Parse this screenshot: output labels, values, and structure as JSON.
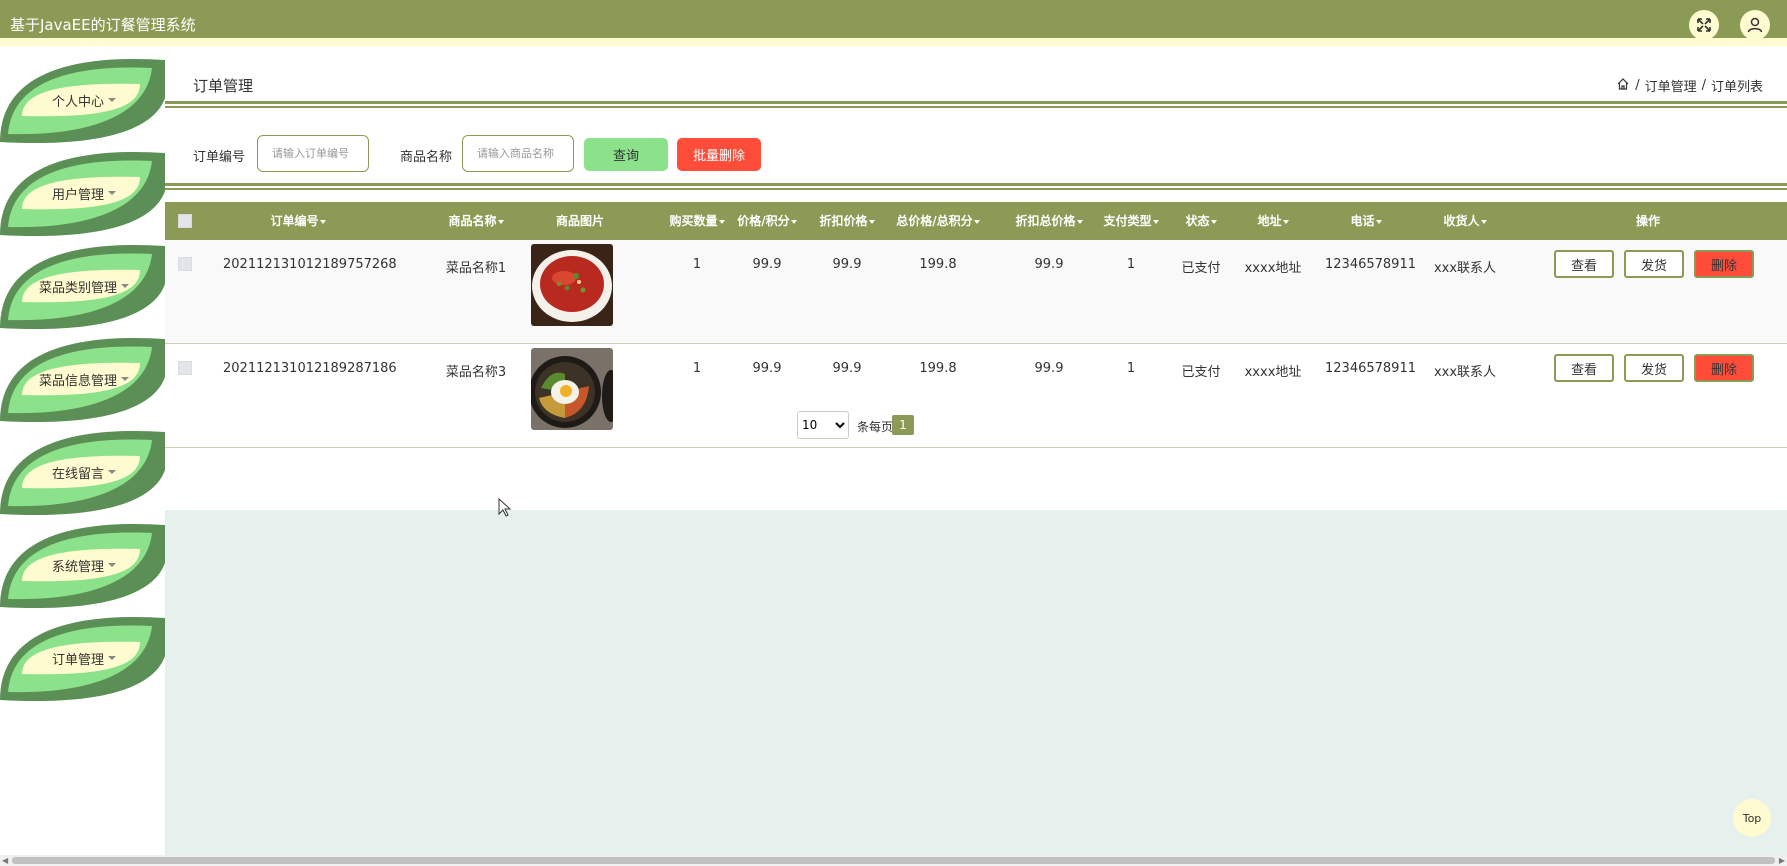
{
  "app": {
    "title": "基于JavaEE的订餐管理系统"
  },
  "header_icons": [
    "fullscreen-icon",
    "user-icon"
  ],
  "sidebar": {
    "items": [
      {
        "label": "个人中心"
      },
      {
        "label": "用户管理"
      },
      {
        "label": "菜品类别管理"
      },
      {
        "label": "菜品信息管理"
      },
      {
        "label": "在线留言"
      },
      {
        "label": "系统管理"
      },
      {
        "label": "订单管理"
      }
    ]
  },
  "page": {
    "title": "订单管理",
    "breadcrumb": [
      "订单管理",
      "订单列表"
    ]
  },
  "search": {
    "order_label": "订单编号",
    "order_placeholder": "请输入订单编号",
    "product_label": "商品名称",
    "product_placeholder": "请输入商品名称",
    "query_label": "查询",
    "batch_delete_label": "批量删除"
  },
  "table": {
    "columns": [
      "订单编号",
      "商品名称",
      "商品图片",
      "购买数量",
      "价格/积分",
      "折扣价格",
      "总价格/总积分",
      "折扣总价格",
      "支付类型",
      "状态",
      "地址",
      "电话",
      "收货人",
      "操作"
    ],
    "rows": [
      {
        "order_no": "202112131012189757268",
        "product": "菜品名称1",
        "qty": "1",
        "price": "99.9",
        "discount": "99.9",
        "total": "199.8",
        "discount_total": "99.9",
        "pay_type": "1",
        "status": "已支付",
        "address": "xxxx地址",
        "phone": "12346578911",
        "receiver": "xxx联系人",
        "image": "red-dish-image"
      },
      {
        "order_no": "202112131012189287186",
        "product": "菜品名称3",
        "qty": "1",
        "price": "99.9",
        "discount": "99.9",
        "total": "199.8",
        "discount_total": "99.9",
        "pay_type": "1",
        "status": "已支付",
        "address": "xxxx地址",
        "phone": "12346578911",
        "receiver": "xxx联系人",
        "image": "bibimbap-image"
      }
    ],
    "actions": {
      "view": "查看",
      "ship": "发货",
      "delete": "删除"
    }
  },
  "pagination": {
    "page_size": "10",
    "per_page_label": "条每页",
    "current_page": "1"
  },
  "back_to_top": "Top",
  "colors": {
    "primary": "#8b9b55",
    "accent_light": "#fffbd0",
    "leaf_green": "#5c8f55",
    "leaf_light": "#8be28a",
    "danger": "#ff4d3a",
    "content_bg": "#e6f0ec"
  }
}
